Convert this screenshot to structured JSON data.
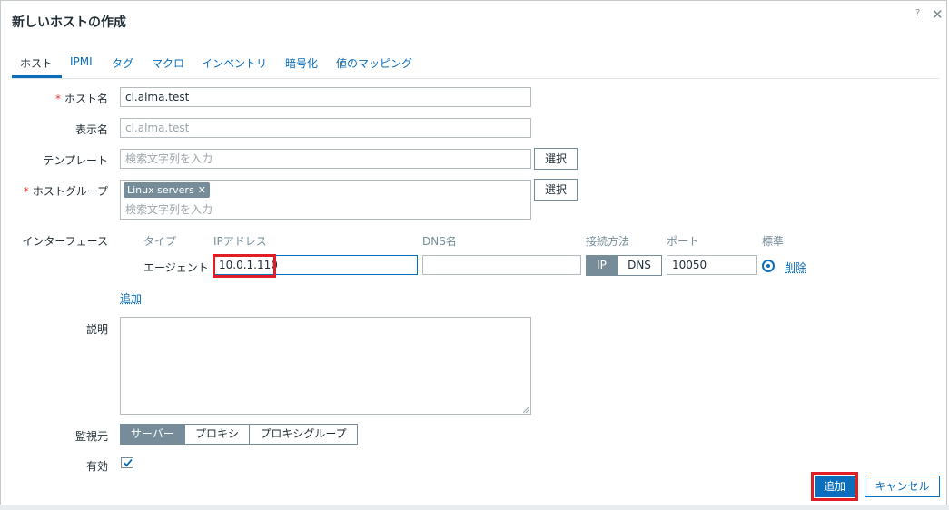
{
  "dialog": {
    "title": "新しいホストの作成",
    "help_glyph": "?",
    "close_glyph": "✕"
  },
  "tabs": [
    {
      "label": "ホスト",
      "active": true
    },
    {
      "label": "IPMI"
    },
    {
      "label": "タグ"
    },
    {
      "label": "マクロ"
    },
    {
      "label": "インベントリ"
    },
    {
      "label": "暗号化"
    },
    {
      "label": "値のマッピング"
    }
  ],
  "form": {
    "required_mark": "*",
    "host_name": {
      "label": "ホスト名",
      "value": "cl.alma.test"
    },
    "visible_name": {
      "label": "表示名",
      "placeholder": "cl.alma.test"
    },
    "templates": {
      "label": "テンプレート",
      "placeholder": "検索文字列を入力",
      "select_label": "選択"
    },
    "host_groups": {
      "label": "ホストグループ",
      "chip": "Linux servers",
      "chip_remove": "✕",
      "placeholder": "検索文字列を入力",
      "select_label": "選択"
    },
    "interfaces": {
      "label": "インターフェース",
      "columns": {
        "type": "タイプ",
        "ip": "IPアドレス",
        "dns": "DNS名",
        "connect": "接続方法",
        "port": "ポート",
        "default": "標準"
      },
      "rows": [
        {
          "type": "エージェント",
          "ip": "10.0.1.110",
          "dns": "",
          "connect_options": [
            "IP",
            "DNS"
          ],
          "connect_selected": "IP",
          "port": "10050",
          "default": true,
          "remove_label": "削除"
        }
      ],
      "add_label": "追加"
    },
    "description": {
      "label": "説明",
      "value": ""
    },
    "monitored_by": {
      "label": "監視元",
      "options": [
        "サーバー",
        "プロキシ",
        "プロキシグループ"
      ],
      "selected": "サーバー"
    },
    "enabled": {
      "label": "有効",
      "checked": true
    }
  },
  "footer": {
    "add_label": "追加",
    "cancel_label": "キャンセル"
  },
  "colors": {
    "accent": "#0a6ebd",
    "highlight_box": "#e11d26",
    "required": "#e33734"
  }
}
